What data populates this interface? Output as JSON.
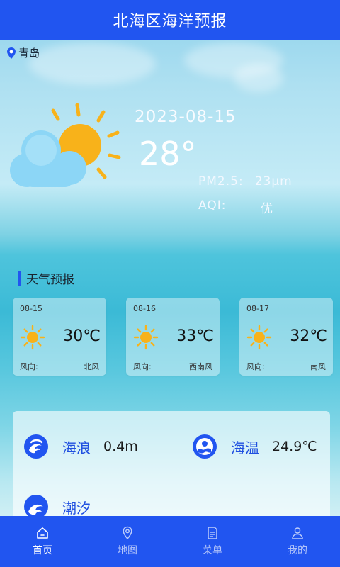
{
  "header": {
    "title": "北海区海洋预报"
  },
  "location": {
    "icon": "location-pin-icon",
    "name": "青岛"
  },
  "current": {
    "date": "2023-08-15",
    "temperature": "28°",
    "icon": "partly-cloudy-icon",
    "pm25_label": "PM2.5:",
    "pm25_value": "23μm",
    "aqi_label": "AQI:",
    "aqi_value": "优"
  },
  "forecast": {
    "title": "天气预报",
    "days": [
      {
        "date": "08-15",
        "icon": "sun-icon",
        "temp": "30℃",
        "wind_label": "风向:",
        "wind_value": "北风"
      },
      {
        "date": "08-16",
        "icon": "sun-icon",
        "temp": "33℃",
        "wind_label": "风向:",
        "wind_value": "西南风"
      },
      {
        "date": "08-17",
        "icon": "sun-icon",
        "temp": "32℃",
        "wind_label": "风向:",
        "wind_value": "南风"
      }
    ]
  },
  "ocean": {
    "wave": {
      "icon": "wave-icon",
      "label": "海浪",
      "value": "0.4m"
    },
    "water_temp": {
      "icon": "water-temperature-icon",
      "label": "海温",
      "value": "24.9℃"
    },
    "tide": {
      "icon": "tide-icon",
      "label": "潮汐"
    }
  },
  "nav": {
    "items": [
      {
        "label": "首页",
        "icon": "home-icon",
        "active": true
      },
      {
        "label": "地图",
        "icon": "map-pin-icon",
        "active": false
      },
      {
        "label": "菜单",
        "icon": "menu-document-icon",
        "active": false
      },
      {
        "label": "我的",
        "icon": "user-icon",
        "active": false
      }
    ]
  },
  "colors": {
    "primary": "#2155f0",
    "sun": "#f8b21a",
    "cloud": "#7fd0f4"
  }
}
